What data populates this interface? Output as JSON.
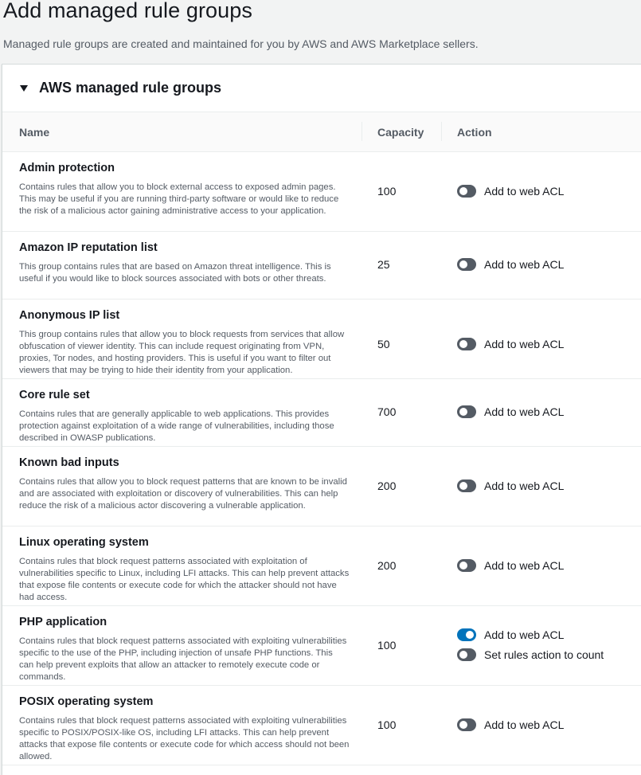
{
  "page": {
    "title": "Add managed rule groups",
    "description": "Managed rule groups are created and maintained for you by AWS and AWS Marketplace sellers."
  },
  "panel": {
    "title": "AWS managed rule groups",
    "expanded": true
  },
  "table": {
    "columns": {
      "name": "Name",
      "capacity": "Capacity",
      "action": "Action"
    },
    "rows": [
      {
        "name": "Admin protection",
        "description": "Contains rules that allow you to block external access to exposed admin pages. This may be useful if you are running third-party software or would like to reduce the risk of a malicious actor gaining administrative access to your application.",
        "capacity": "100",
        "toggles": [
          {
            "label": "Add to web ACL",
            "on": false
          }
        ]
      },
      {
        "name": "Amazon IP reputation list",
        "description": "This group contains rules that are based on Amazon threat intelligence. This is useful if you would like to block sources associated with bots or other threats.",
        "capacity": "25",
        "toggles": [
          {
            "label": "Add to web ACL",
            "on": false
          }
        ]
      },
      {
        "name": "Anonymous IP list",
        "description": "This group contains rules that allow you to block requests from services that allow obfuscation of viewer identity. This can include request originating from VPN, proxies, Tor nodes, and hosting providers. This is useful if you want to filter out viewers that may be trying to hide their identity from your application.",
        "capacity": "50",
        "toggles": [
          {
            "label": "Add to web ACL",
            "on": false
          }
        ]
      },
      {
        "name": "Core rule set",
        "description": "Contains rules that are generally applicable to web applications. This provides protection against exploitation of a wide range of vulnerabilities, including those described in OWASP publications.",
        "capacity": "700",
        "toggles": [
          {
            "label": "Add to web ACL",
            "on": false
          }
        ]
      },
      {
        "name": "Known bad inputs",
        "description": "Contains rules that allow you to block request patterns that are known to be invalid and are associated with exploitation or discovery of vulnerabilities. This can help reduce the risk of a malicious actor discovering a vulnerable application.",
        "capacity": "200",
        "toggles": [
          {
            "label": "Add to web ACL",
            "on": false
          }
        ]
      },
      {
        "name": "Linux operating system",
        "description": "Contains rules that block request patterns associated with exploitation of vulnerabilities specific to Linux, including LFI attacks. This can help prevent attacks that expose file contents or execute code for which the attacker should not have had access.",
        "capacity": "200",
        "toggles": [
          {
            "label": "Add to web ACL",
            "on": false
          }
        ]
      },
      {
        "name": "PHP application",
        "description": "Contains rules that block request patterns associated with exploiting vulnerabilities specific to the use of the PHP, including injection of unsafe PHP functions. This can help prevent exploits that allow an attacker to remotely execute code or commands.",
        "capacity": "100",
        "toggles": [
          {
            "label": "Add to web ACL",
            "on": true
          },
          {
            "label": "Set rules action to count",
            "on": false
          }
        ]
      },
      {
        "name": "POSIX operating system",
        "description": "Contains rules that block request patterns associated with exploiting vulnerabilities specific to POSIX/POSIX-like OS, including LFI attacks. This can help prevent attacks that expose file contents or execute code for which access should not been allowed.",
        "capacity": "100",
        "toggles": [
          {
            "label": "Add to web ACL",
            "on": false
          }
        ]
      }
    ]
  },
  "colors": {
    "toggle_on": "#0073bb",
    "toggle_off": "#545b64",
    "page_background": "#f2f3f3"
  }
}
